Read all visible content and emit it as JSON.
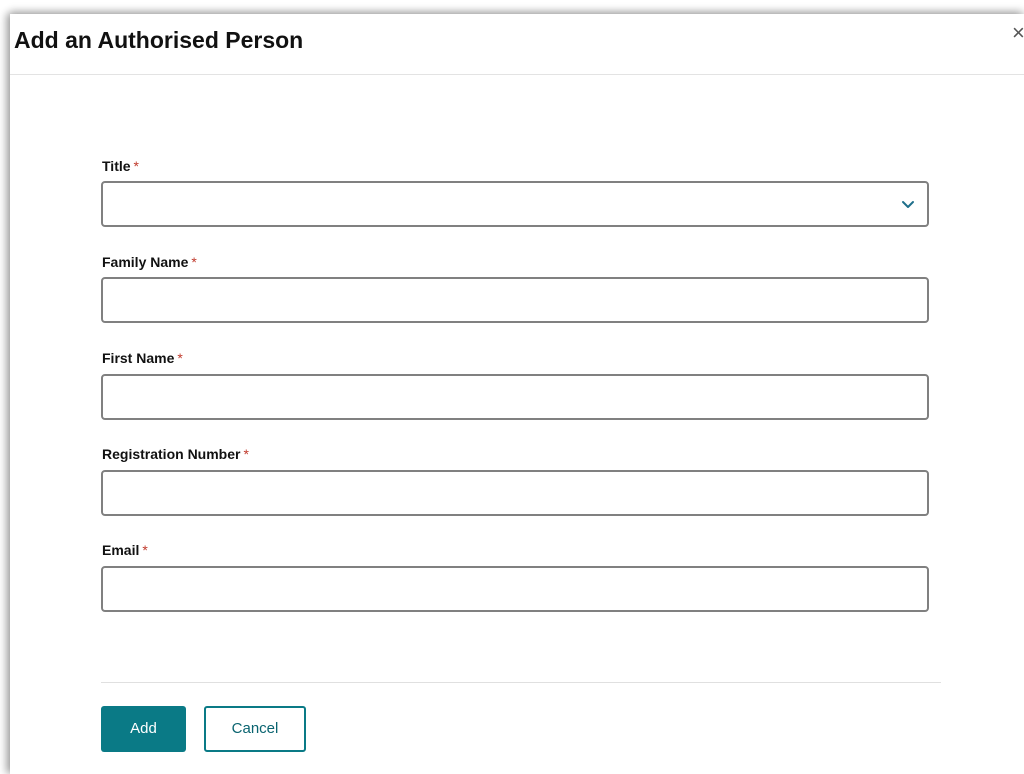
{
  "dialog": {
    "title": "Add an Authorised Person",
    "close_symbol": "×"
  },
  "form": {
    "required_marker": "*",
    "fields": [
      {
        "label": "Title",
        "type": "select",
        "value": "",
        "icon": "chevron-down-icon"
      },
      {
        "label": "Family Name",
        "type": "text",
        "value": ""
      },
      {
        "label": "First Name",
        "type": "text",
        "value": ""
      },
      {
        "label": "Registration Number",
        "type": "text",
        "value": ""
      },
      {
        "label": "Email",
        "type": "text",
        "value": ""
      }
    ]
  },
  "actions": {
    "add_label": "Add",
    "cancel_label": "Cancel"
  },
  "colors": {
    "accent": "#0a7a86",
    "required": "#c0392b",
    "field_border": "#808080",
    "chevron": "#1f6f8b"
  }
}
